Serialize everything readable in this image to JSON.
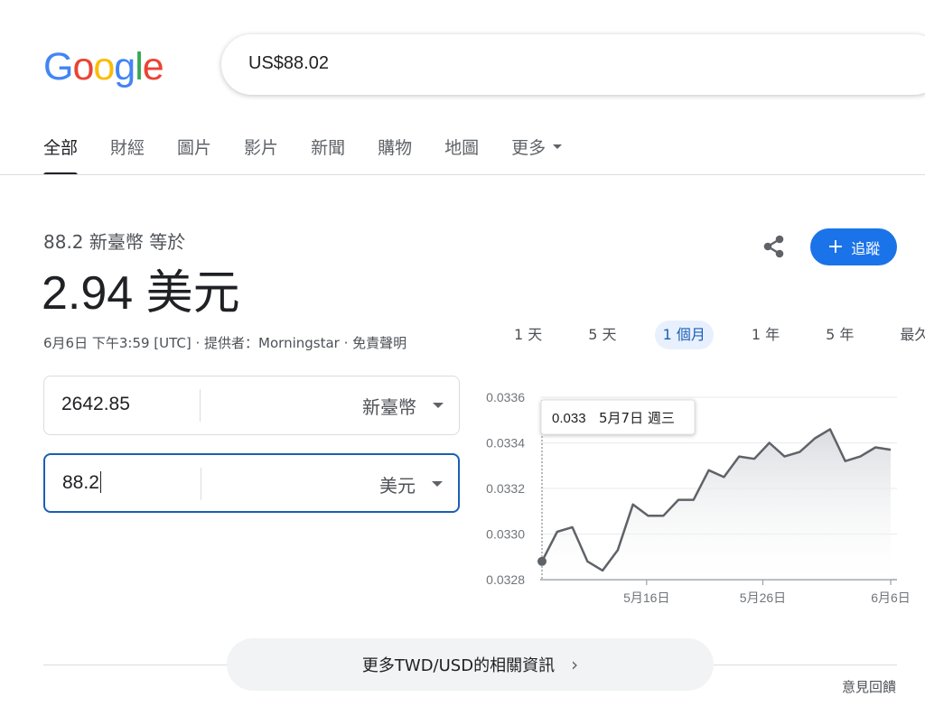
{
  "logo": {
    "letters": [
      "G",
      "o",
      "o",
      "g",
      "l",
      "e"
    ],
    "colors": [
      "#4285f4",
      "#ea4335",
      "#fbbc05",
      "#4285f4",
      "#34a853",
      "#ea4335"
    ]
  },
  "search": {
    "query": "US$88.02"
  },
  "tabs": [
    {
      "label": "全部",
      "active": true
    },
    {
      "label": "財經"
    },
    {
      "label": "圖片"
    },
    {
      "label": "影片"
    },
    {
      "label": "新聞"
    },
    {
      "label": "購物"
    },
    {
      "label": "地圖"
    },
    {
      "label": "更多",
      "dropdown": true
    }
  ],
  "converter": {
    "from_line": "88.2 新臺幣 等於",
    "result": "2.94 美元",
    "meta": "6月6日 下午3:59 [UTC] · 提供者：Morningstar · 免責聲明",
    "follow_label": "追蹤",
    "share_icon": "share-icon",
    "row1": {
      "value": "2642.85",
      "unit": "新臺幣"
    },
    "row2": {
      "value": "88.2",
      "unit": "美元"
    }
  },
  "ranges": [
    {
      "label": "1 天"
    },
    {
      "label": "5 天"
    },
    {
      "label": "1 個月",
      "active": true
    },
    {
      "label": "1 年"
    },
    {
      "label": "5 年"
    },
    {
      "label": "最久"
    }
  ],
  "chart_data": {
    "type": "area",
    "x": [
      "5月7日",
      "5月8日",
      "5月9日",
      "5月10日",
      "5月11日",
      "5月12日",
      "5月13日",
      "5月14日",
      "5月15日",
      "5月16日",
      "5月17日",
      "5月18日",
      "5月19日",
      "5月20日",
      "5月21日",
      "5月22日",
      "5月23日",
      "5月24日",
      "5月25日",
      "5月26日",
      "5月27日",
      "5月28日",
      "5月29日",
      "5月30日",
      "5月31日",
      "6月1日",
      "6月2日",
      "6月3日",
      "6月4日",
      "6月5日",
      "6月6日"
    ],
    "values": [
      0.03288,
      0.03301,
      0.03303,
      0.03288,
      0.03284,
      0.03293,
      0.03313,
      0.03308,
      0.03308,
      0.03315,
      0.03315,
      0.03328,
      0.03325,
      0.03334,
      0.03333,
      0.0334,
      0.03334,
      0.03336,
      0.03342,
      0.03346,
      0.03332,
      0.03334,
      0.03338,
      0.03337
    ],
    "ylim": [
      0.0328,
      0.0336
    ],
    "yticks": [
      "0.0336",
      "0.0334",
      "0.0332",
      "0.0330",
      "0.0328"
    ],
    "xticks": [
      "5月16日",
      "5月26日",
      "6月6日"
    ],
    "tooltip": {
      "value": "0.033",
      "date": "5月7日 週三"
    },
    "colors": {
      "line": "#5f6368",
      "fill": "#e8eaed",
      "grid": "#e8eaed",
      "marker": "#5f6368"
    }
  },
  "footer": {
    "more_label": "更多TWD/USD的相關資訊",
    "feedback": "意見回饋"
  }
}
